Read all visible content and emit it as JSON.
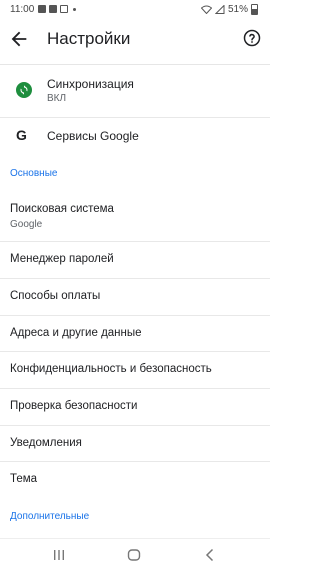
{
  "status_bar": {
    "time": "11:00",
    "battery": "51%"
  },
  "app_bar": {
    "title": "Настройки"
  },
  "account": {
    "sync": {
      "title": "Синхронизация",
      "status": "ВКЛ",
      "status_color": "#1e8e3e"
    },
    "google_services": {
      "title": "Сервисы Google"
    }
  },
  "sections": {
    "basic": "Основные",
    "advanced": "Дополнительные"
  },
  "menu": {
    "search_engine": {
      "title": "Поисковая система",
      "value": "Google"
    },
    "password_manager": "Менеджер паролей",
    "payment_methods": "Способы оплаты",
    "addresses": "Адреса и другие данные",
    "privacy": "Конфиденциальность и безопасность",
    "safety_check": "Проверка безопасности",
    "notifications": "Уведомления",
    "theme": "Тема"
  },
  "colors": {
    "accent": "#1a73e8",
    "text": "#202124",
    "secondary": "#5f6368"
  }
}
